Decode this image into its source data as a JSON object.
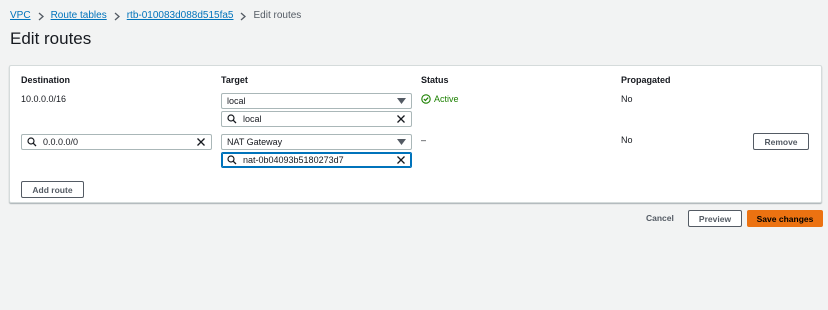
{
  "breadcrumb": {
    "items": [
      "VPC",
      "Route tables",
      "rtb-010083d088d515fa5"
    ],
    "current": "Edit routes"
  },
  "page": {
    "title": "Edit routes"
  },
  "table": {
    "headers": {
      "destination": "Destination",
      "target": "Target",
      "status": "Status",
      "propagated": "Propagated"
    },
    "rows": [
      {
        "destination": "10.0.0.0/16",
        "target_type": "local",
        "target_value": "local",
        "status": "Active",
        "propagated": "No"
      },
      {
        "destination": "0.0.0.0/0",
        "target_type": "NAT Gateway",
        "target_value": "nat-0b04093b5180273d7",
        "status": "–",
        "propagated": "No",
        "remove_label": "Remove"
      }
    ],
    "add_route_label": "Add route"
  },
  "footer": {
    "cancel_label": "Cancel",
    "preview_label": "Preview",
    "save_label": "Save changes"
  },
  "colors": {
    "link": "#0073bb",
    "status_active": "#1d8102",
    "primary": "#ec7211",
    "background": "#f2f3f3"
  }
}
